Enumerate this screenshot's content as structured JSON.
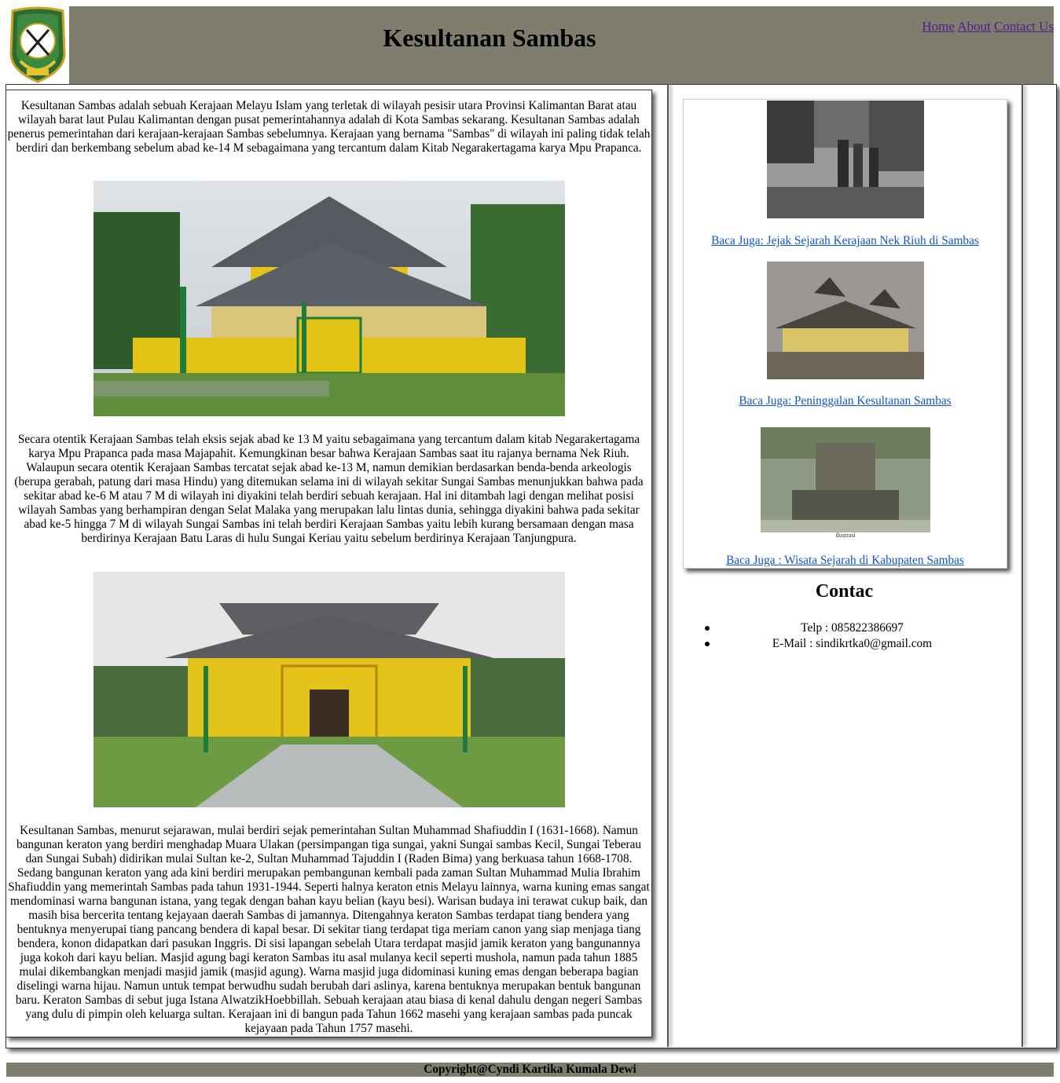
{
  "header": {
    "title": "Kesultanan Sambas",
    "nav": [
      "Home",
      "About",
      "Contact Us"
    ]
  },
  "main": {
    "paragraphs": [
      "Kesultanan Sambas adalah sebuah Kerajaan Melayu Islam yang terletak di wilayah pesisir utara Provinsi Kalimantan Barat atau wilayah barat laut Pulau Kalimantan dengan pusat pemerintahannya adalah di Kota Sambas sekarang. Kesultanan Sambas adalah penerus pemerintahan dari kerajaan-kerajaan Sambas sebelumnya. Kerajaan yang bernama \"Sambas\" di wilayah ini paling tidak telah berdiri dan berkembang sebelum abad ke-14 M sebagaimana yang tercantum dalam Kitab Negarakertagama karya Mpu Prapanca.",
      "Secara otentik Kerajaan Sambas telah eksis sejak abad ke 13 M yaitu sebagaimana yang tercantum dalam kitab Negarakertagama karya Mpu Prapanca pada masa Majapahit. Kemungkinan besar bahwa Kerajaan Sambas saat itu rajanya bernama Nek Riuh. Walaupun secara otentik Kerajaan Sambas tercatat sejak abad ke-13 M, namun demikian berdasarkan benda-benda arkeologis (berupa gerabah, patung dari masa Hindu) yang ditemukan selama ini di wilayah sekitar Sungai Sambas menunjukkan bahwa pada sekitar abad ke-6 M atau 7 M di wilayah ini diyakini telah berdiri sebuah kerajaan. Hal ini ditambah lagi dengan melihat posisi wilayah Sambas yang berhampiran dengan Selat Malaka yang merupakan lalu lintas dunia, sehingga diyakini bahwa pada sekitar abad ke-5 hingga 7 M di wilayah Sungai Sambas ini telah berdiri Kerajaan Sambas yaitu lebih kurang bersamaan dengan masa berdirinya Kerajaan Batu Laras di hulu Sungai Keriau yaitu sebelum berdirinya Kerajaan Tanjungpura.",
      "Kesultanan Sambas, menurut sejarawan, mulai berdiri sejak pemerintahan Sultan Muhammad Shafiuddin I (1631-1668). Namun bangunan keraton yang berdiri menghadap Muara Ulakan (persimpangan tiga sungai, yakni Sungai sambas Kecil, Sungai Teberau dan Sungai Subah) didirikan mulai Sultan ke-2, Sultan Muhammad Tajuddin I (Raden Bima) yang berkuasa tahun 1668-1708. Sedang bangunan keraton yang ada kini berdiri merupakan pembangunan kembali pada zaman Sultan Muhammad Mulia Ibrahim Shafiuddin yang memerintah Sambas pada tahun 1931-1944. Seperti halnya keraton etnis Melayu lainnya, warna kuning emas sangat mendominasi warna bangunan istana, yang tegak dengan bahan kayu belian (kayu besi). Warisan budaya ini terawat cukup baik, dan masih bisa bercerita tentang kejayaan daerah Sambas di jamannya. Ditengahnya keraton Sambas terdapat tiang bendera yang bentuknya menyerupai tiang pancang bendera di kapal besar. Di sekitar tiang terdapat tiga meriam canon yang siap menjaga tiang bendera, konon didapatkan dari pasukan Inggris. Di sisi lapangan sebelah Utara terdapat masjid jamik keraton yang bangunannya juga kokoh dari kayu belian. Masjid agung bagi keraton Sambas itu asal mulanya kecil seperti mushola, namun pada tahun 1885 mulai dikembangkan menjadi masjid jamik (masjid agung). Warna masjid juga didominasi kuning emas dengan beberapa bagian diselingi warna hijau. Namun untuk tempat berwudhu sudah berubah dari aslinya, karena bentuknya merupakan bentuk bangunan baru. Keraton Sambas di sebut juga Istana AlwatzikHoebbillah. Sebuah kerajaan atau biasa di kenal dahulu dengan negeri Sambas yang dulu di pimpin oleh keluarga sultan. Kerajaan ini di bangun pada Tahun 1662 masehi yang kerajaan sambas pada puncak kejayaan pada Tahun 1757 masehi."
    ]
  },
  "sidebar": {
    "links": [
      "Baca Juga: Jejak Sejarah Kerajaan Nek Riuh di Sambas",
      "Baca Juga: Peninggalan Kesultanan Sambas",
      "Baca Juga : Wisata Sejarah di Kabupaten Sambas"
    ],
    "thumb3_caption": "ilustrasi",
    "contact": {
      "title": "Contac",
      "items": [
        "Telp : 085822386697",
        "E-Mail : sindikrtka0@gmail.com"
      ]
    }
  },
  "footer": {
    "text": "Copyright@Cyndi Kartika Kumala Dewi"
  },
  "colors": {
    "bar": "#7e7d6e",
    "link": "#1155cc",
    "nav_link": "#551a8b"
  }
}
